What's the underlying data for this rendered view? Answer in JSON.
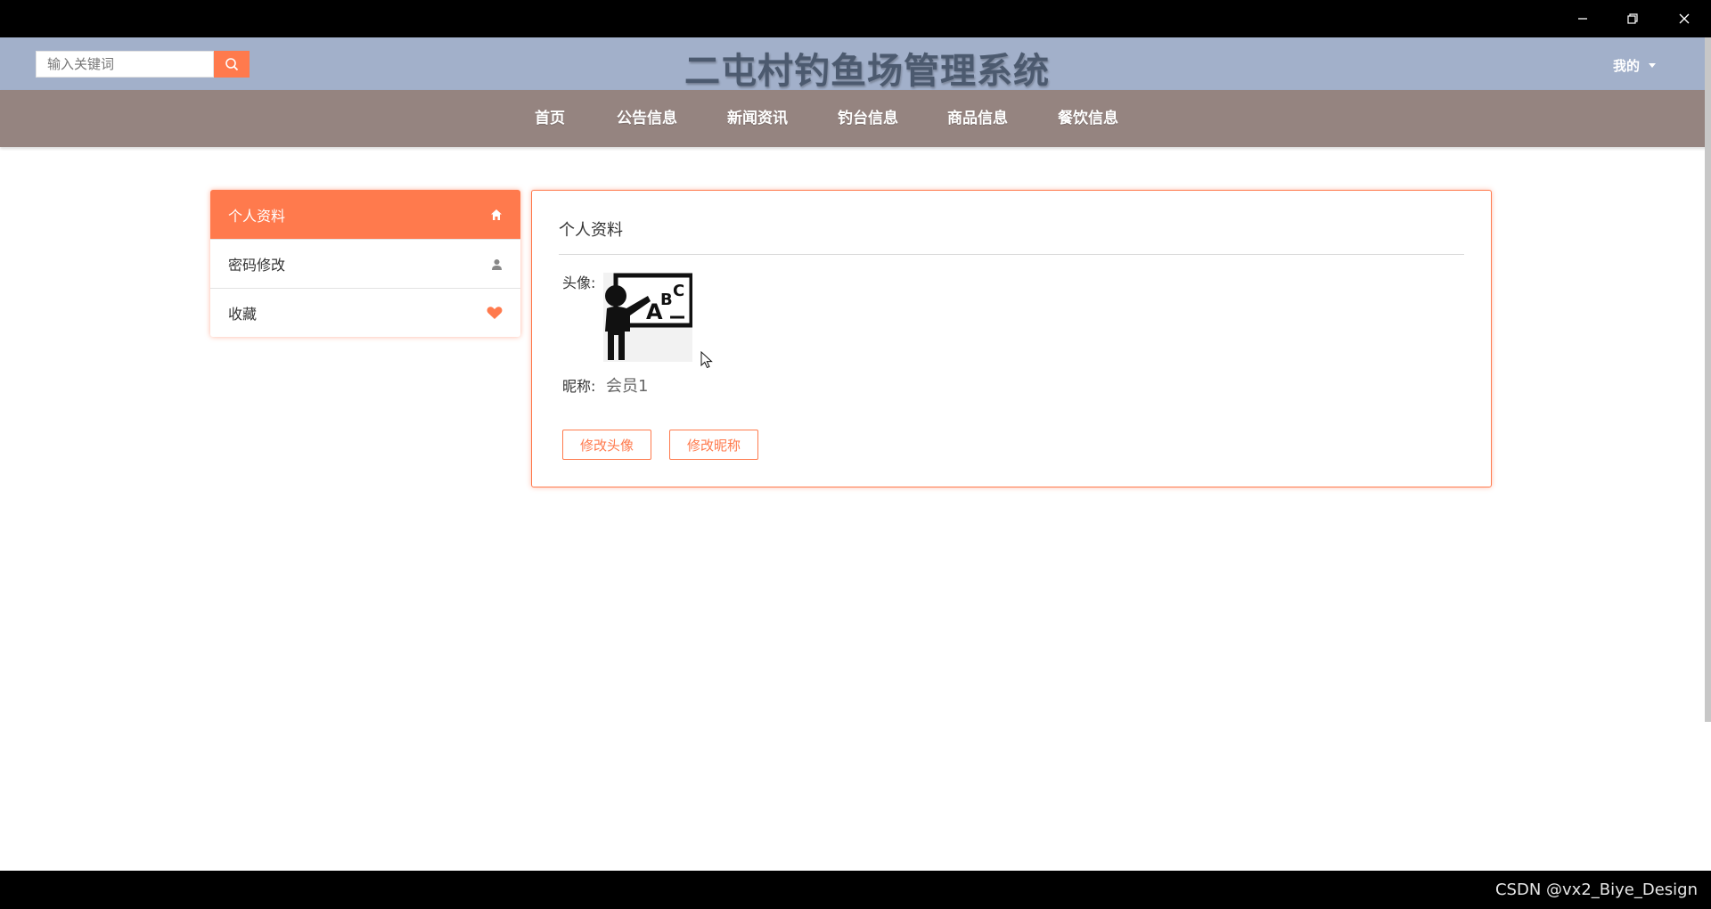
{
  "window": {
    "minimize_icon": "minimize-icon",
    "restore_icon": "restore-icon",
    "close_icon": "close-icon"
  },
  "header": {
    "search_placeholder": "输入关键词",
    "search_icon": "search-icon",
    "title": "二屯村钓鱼场管理系统",
    "user_menu": "我的",
    "colors": {
      "header_bg": "#a2b0ca",
      "accent": "#ff7a4d",
      "nav_bg": "#958480"
    }
  },
  "nav": {
    "items": [
      {
        "label": "首页"
      },
      {
        "label": "公告信息"
      },
      {
        "label": "新闻资讯"
      },
      {
        "label": "钓台信息"
      },
      {
        "label": "商品信息"
      },
      {
        "label": "餐饮信息"
      }
    ]
  },
  "sidebar": {
    "items": [
      {
        "label": "个人资料",
        "icon": "home-icon",
        "active": true
      },
      {
        "label": "密码修改",
        "icon": "user-icon",
        "active": false
      },
      {
        "label": "收藏",
        "icon": "heart-icon",
        "active": false
      }
    ]
  },
  "profile": {
    "title": "个人资料",
    "avatar_label": "头像:",
    "avatar_alt": "teacher-at-blackboard-avatar",
    "nickname_label": "昵称:",
    "nickname_value": "会员1",
    "change_avatar_button": "修改头像",
    "change_nickname_button": "修改昵称"
  },
  "footer": {
    "watermark": "CSDN @vx2_Biye_Design"
  }
}
